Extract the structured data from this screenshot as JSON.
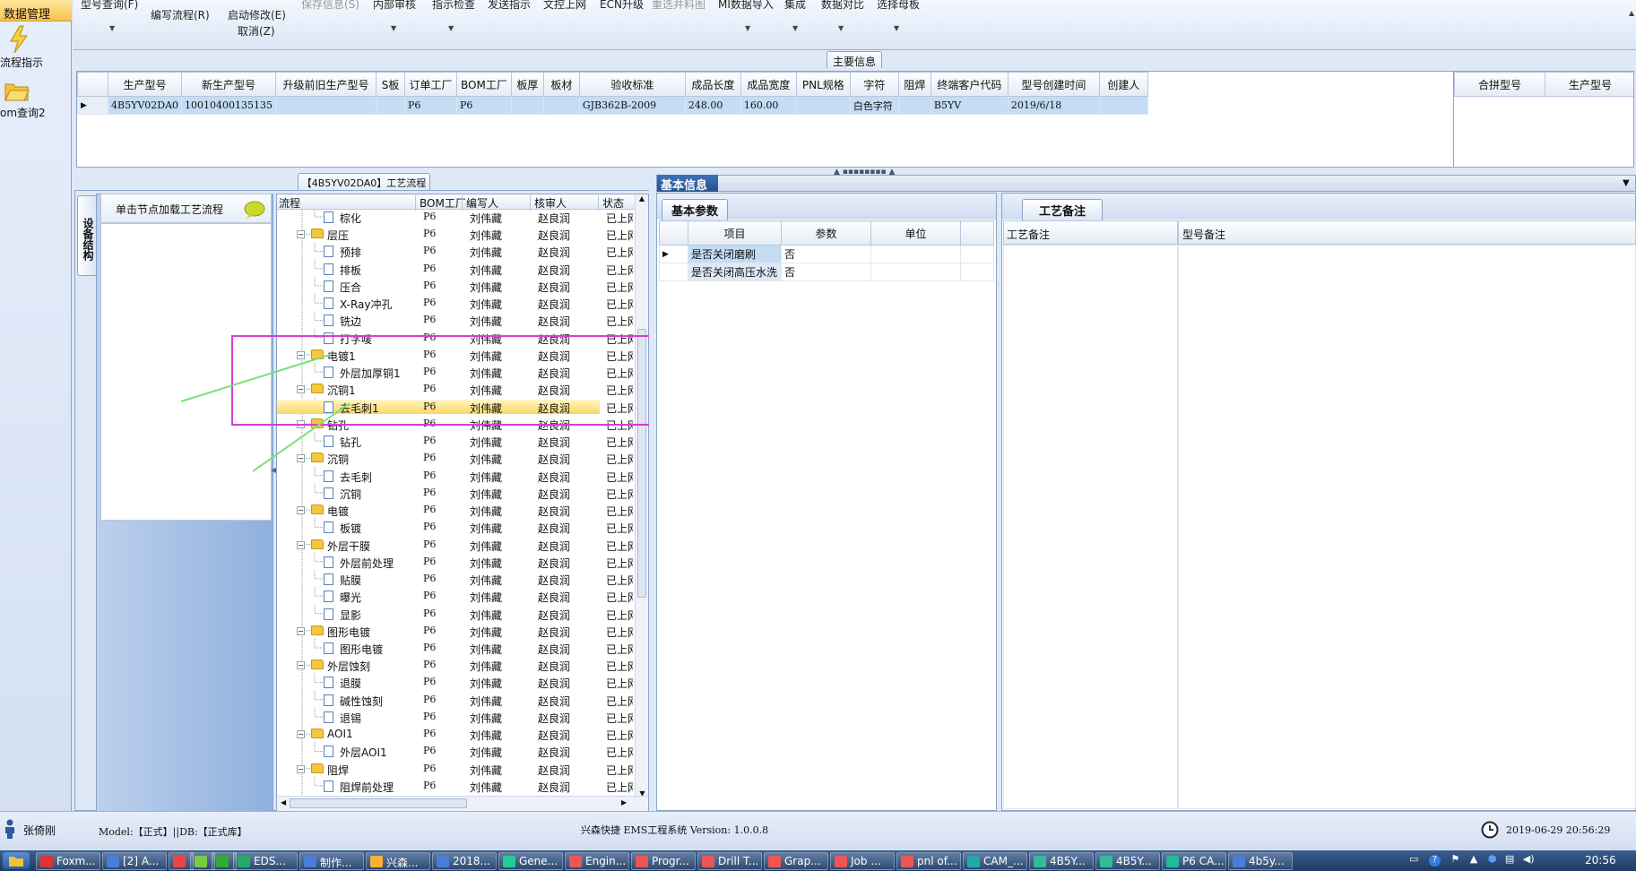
{
  "nav": {
    "header": "数据管理",
    "items": [
      {
        "label": "流程指示"
      },
      {
        "label": "om查询2"
      }
    ]
  },
  "toolbar": {
    "items": [
      {
        "label": "型号查询(F)",
        "dim": false
      },
      {
        "label": "编写流程(R)",
        "dim": false
      },
      {
        "label": "启动修改(E)",
        "dim": false
      },
      {
        "label": "取消(Z)",
        "dim": false
      },
      {
        "label": "保存信息(S)",
        "dim": true
      },
      {
        "label": "内部审核",
        "dim": false
      },
      {
        "label": "指示检查",
        "dim": false
      },
      {
        "label": "发送指示",
        "dim": false
      },
      {
        "label": "文控上网",
        "dim": false
      },
      {
        "label": "ECN升级",
        "dim": false
      },
      {
        "label": "重选并料图",
        "dim": true
      },
      {
        "label": "MI数据导入",
        "dim": false
      },
      {
        "label": "集成",
        "dim": false
      },
      {
        "label": "数据对比",
        "dim": false
      },
      {
        "label": "选择母板",
        "dim": false
      }
    ]
  },
  "main_info": {
    "title": "主要信息",
    "columns": [
      "生产型号",
      "新生产型号",
      "升级前旧生产型号",
      "S板",
      "订单工厂",
      "BOM工厂",
      "板厚",
      "板材",
      "验收标准",
      "成品长度",
      "成品宽度",
      "PNL规格",
      "字符",
      "阻焊",
      "终端客户代码",
      "型号创建时间",
      "创建人"
    ],
    "rows": [
      [
        "4B5YV02DA0",
        "10010400135135",
        "",
        "",
        "P6",
        "P6",
        "",
        "",
        "GJB362B-2009",
        "248.00",
        "160.00",
        "",
        "白色字符",
        "",
        "B5YV",
        "2019/6/18",
        ""
      ]
    ],
    "side_columns": [
      "合拼型号",
      "生产型号"
    ]
  },
  "flow_panel": {
    "title": "【4B5YV02DA0】工艺流程",
    "load_hint": "单击节点加载工艺流程",
    "vtab": "设备结构",
    "columns": [
      "流程",
      "BOM工厂",
      "编写人",
      "核审人",
      "状态"
    ],
    "rows": [
      {
        "name": "棕化",
        "folder": false,
        "bom": "P6",
        "writer": "刘伟藏",
        "checker": "赵良润",
        "status": "已上网"
      },
      {
        "name": "层压",
        "folder": true,
        "bom": "P6",
        "writer": "刘伟藏",
        "checker": "赵良润",
        "status": "已上网"
      },
      {
        "name": "预排",
        "folder": false,
        "bom": "P6",
        "writer": "刘伟藏",
        "checker": "赵良润",
        "status": "已上网"
      },
      {
        "name": "排板",
        "folder": false,
        "bom": "P6",
        "writer": "刘伟藏",
        "checker": "赵良润",
        "status": "已上网"
      },
      {
        "name": "压合",
        "folder": false,
        "bom": "P6",
        "writer": "刘伟藏",
        "checker": "赵良润",
        "status": "已上网"
      },
      {
        "name": "X-Ray冲孔",
        "folder": false,
        "bom": "P6",
        "writer": "刘伟藏",
        "checker": "赵良润",
        "status": "已上网"
      },
      {
        "name": "铣边",
        "folder": false,
        "bom": "P6",
        "writer": "刘伟藏",
        "checker": "赵良润",
        "status": "已上网"
      },
      {
        "name": "打字唛",
        "folder": false,
        "bom": "P6",
        "writer": "刘伟藏",
        "checker": "赵良润",
        "status": "已上网"
      },
      {
        "name": "电镀1",
        "folder": true,
        "bom": "P6",
        "writer": "刘伟藏",
        "checker": "赵良润",
        "status": "已上网"
      },
      {
        "name": "外层加厚铜1",
        "folder": false,
        "bom": "P6",
        "writer": "刘伟藏",
        "checker": "赵良润",
        "status": "已上网"
      },
      {
        "name": "沉铜1",
        "folder": true,
        "bom": "P6",
        "writer": "刘伟藏",
        "checker": "赵良润",
        "status": "已上网"
      },
      {
        "name": "去毛刺1",
        "folder": false,
        "bom": "P6",
        "writer": "刘伟藏",
        "checker": "赵良润",
        "status": "已上网",
        "selected": true
      },
      {
        "name": "钻孔",
        "folder": true,
        "bom": "P6",
        "writer": "刘伟藏",
        "checker": "赵良润",
        "status": "已上网"
      },
      {
        "name": "钻孔",
        "folder": false,
        "bom": "P6",
        "writer": "刘伟藏",
        "checker": "赵良润",
        "status": "已上网"
      },
      {
        "name": "沉铜",
        "folder": true,
        "bom": "P6",
        "writer": "刘伟藏",
        "checker": "赵良润",
        "status": "已上网"
      },
      {
        "name": "去毛刺",
        "folder": false,
        "bom": "P6",
        "writer": "刘伟藏",
        "checker": "赵良润",
        "status": "已上网"
      },
      {
        "name": "沉铜",
        "folder": false,
        "bom": "P6",
        "writer": "刘伟藏",
        "checker": "赵良润",
        "status": "已上网"
      },
      {
        "name": "电镀",
        "folder": true,
        "bom": "P6",
        "writer": "刘伟藏",
        "checker": "赵良润",
        "status": "已上网"
      },
      {
        "name": "板镀",
        "folder": false,
        "bom": "P6",
        "writer": "刘伟藏",
        "checker": "赵良润",
        "status": "已上网"
      },
      {
        "name": "外层干膜",
        "folder": true,
        "bom": "P6",
        "writer": "刘伟藏",
        "checker": "赵良润",
        "status": "已上网"
      },
      {
        "name": "外层前处理",
        "folder": false,
        "bom": "P6",
        "writer": "刘伟藏",
        "checker": "赵良润",
        "status": "已上网"
      },
      {
        "name": "贴膜",
        "folder": false,
        "bom": "P6",
        "writer": "刘伟藏",
        "checker": "赵良润",
        "status": "已上网"
      },
      {
        "name": "曝光",
        "folder": false,
        "bom": "P6",
        "writer": "刘伟藏",
        "checker": "赵良润",
        "status": "已上网"
      },
      {
        "name": "显影",
        "folder": false,
        "bom": "P6",
        "writer": "刘伟藏",
        "checker": "赵良润",
        "status": "已上网"
      },
      {
        "name": "图形电镀",
        "folder": true,
        "bom": "P6",
        "writer": "刘伟藏",
        "checker": "赵良润",
        "status": "已上网"
      },
      {
        "name": "图形电镀",
        "folder": false,
        "bom": "P6",
        "writer": "刘伟藏",
        "checker": "赵良润",
        "status": "已上网"
      },
      {
        "name": "外层蚀刻",
        "folder": true,
        "bom": "P6",
        "writer": "刘伟藏",
        "checker": "赵良润",
        "status": "已上网"
      },
      {
        "name": "退膜",
        "folder": false,
        "bom": "P6",
        "writer": "刘伟藏",
        "checker": "赵良润",
        "status": "已上网"
      },
      {
        "name": "碱性蚀刻",
        "folder": false,
        "bom": "P6",
        "writer": "刘伟藏",
        "checker": "赵良润",
        "status": "已上网"
      },
      {
        "name": "退锡",
        "folder": false,
        "bom": "P6",
        "writer": "刘伟藏",
        "checker": "赵良润",
        "status": "已上网"
      },
      {
        "name": "AOI1",
        "folder": true,
        "bom": "P6",
        "writer": "刘伟藏",
        "checker": "赵良润",
        "status": "已上网"
      },
      {
        "name": "外层AOI1",
        "folder": false,
        "bom": "P6",
        "writer": "刘伟藏",
        "checker": "赵良润",
        "status": "已上网"
      },
      {
        "name": "阻焊",
        "folder": true,
        "bom": "P6",
        "writer": "刘伟藏",
        "checker": "赵良润",
        "status": "已上网"
      },
      {
        "name": "阻焊前处理",
        "folder": false,
        "bom": "P6",
        "writer": "刘伟藏",
        "checker": "赵良润",
        "status": "已上网"
      }
    ]
  },
  "basic": {
    "tab": "基本信息",
    "subtab": "基本参数",
    "columns": [
      "项目",
      "参数",
      "单位"
    ],
    "rows": [
      [
        "是否关闭磨刷",
        "否",
        ""
      ],
      [
        "是否关闭高压水洗",
        "否",
        ""
      ]
    ]
  },
  "remarks": {
    "tab": "工艺备注",
    "col1": "工艺备注",
    "col2": "型号备注"
  },
  "status": {
    "user": "张倚刚",
    "model": "Model:【正式】||DB:【正式库】",
    "system": "兴森快捷 EMS工程系统 Version: 1.0.0.8",
    "datetime": "2019-06-29 20:56:29"
  },
  "taskbar": {
    "items": [
      "Foxm...",
      "[2] A...",
      "",
      "",
      "",
      "EDS...",
      "制作...",
      "兴森...",
      "2018...",
      "Gene...",
      "Engin...",
      "Progr...",
      "Drill T...",
      "Grap...",
      "Job ...",
      "pnl of...",
      "CAM_...",
      "4B5Y...",
      "4B5Y...",
      "P6 CA...",
      "4b5y..."
    ],
    "clock": "20:56"
  }
}
